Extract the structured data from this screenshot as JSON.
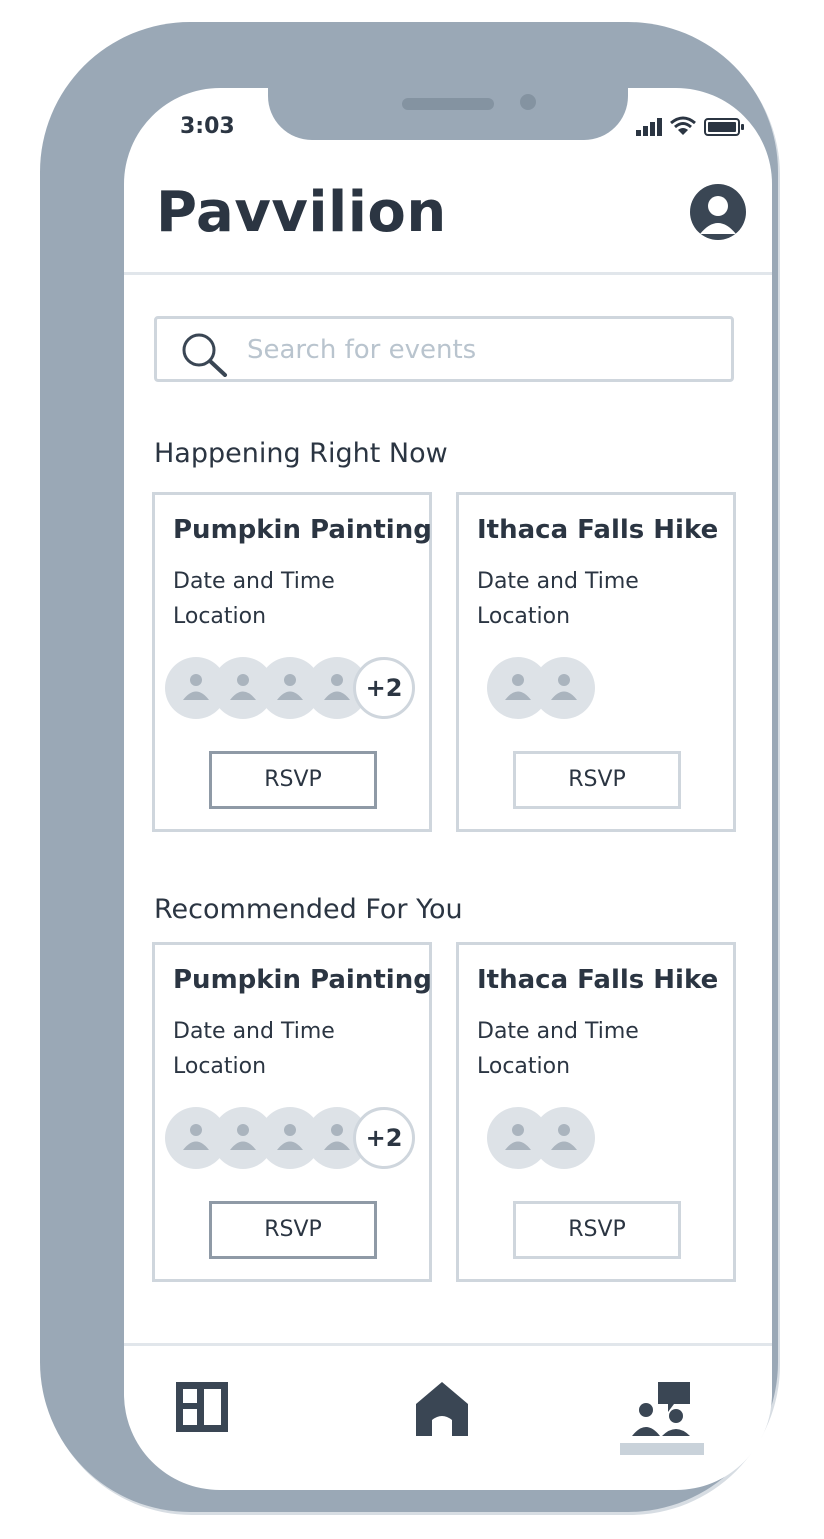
{
  "status_bar": {
    "time": "3:03"
  },
  "header": {
    "title": "Pavvilion"
  },
  "search": {
    "placeholder": "Search for events"
  },
  "sections": [
    {
      "title": "Happening Right Now",
      "cards": [
        {
          "title": "Pumpkin Painting",
          "date_time": "Date and Time",
          "location": "Location",
          "attendee_avatars": 4,
          "extra_attendees": "+2",
          "rsvp_label": "RSVP"
        },
        {
          "title": "Ithaca Falls Hike",
          "date_time": "Date and Time",
          "location": "Location",
          "attendee_avatars": 2,
          "extra_attendees": "",
          "rsvp_label": "RSVP"
        }
      ]
    },
    {
      "title": "Recommended For You",
      "cards": [
        {
          "title": "Pumpkin Painting",
          "date_time": "Date and Time",
          "location": "Location",
          "attendee_avatars": 4,
          "extra_attendees": "+2",
          "rsvp_label": "RSVP"
        },
        {
          "title": "Ithaca Falls Hike",
          "date_time": "Date and Time",
          "location": "Location",
          "attendee_avatars": 2,
          "extra_attendees": "",
          "rsvp_label": "RSVP"
        }
      ]
    }
  ],
  "bottom_nav": {
    "items": [
      {
        "icon": "dashboard-icon"
      },
      {
        "icon": "home-icon"
      },
      {
        "icon": "community-icon",
        "active": true
      }
    ]
  },
  "colors": {
    "frame": "#9aa8b6",
    "text": "#2b3542",
    "border": "#cfd6dd",
    "placeholder": "#b9c4ce",
    "avatar_bg": "#dde2e7"
  }
}
